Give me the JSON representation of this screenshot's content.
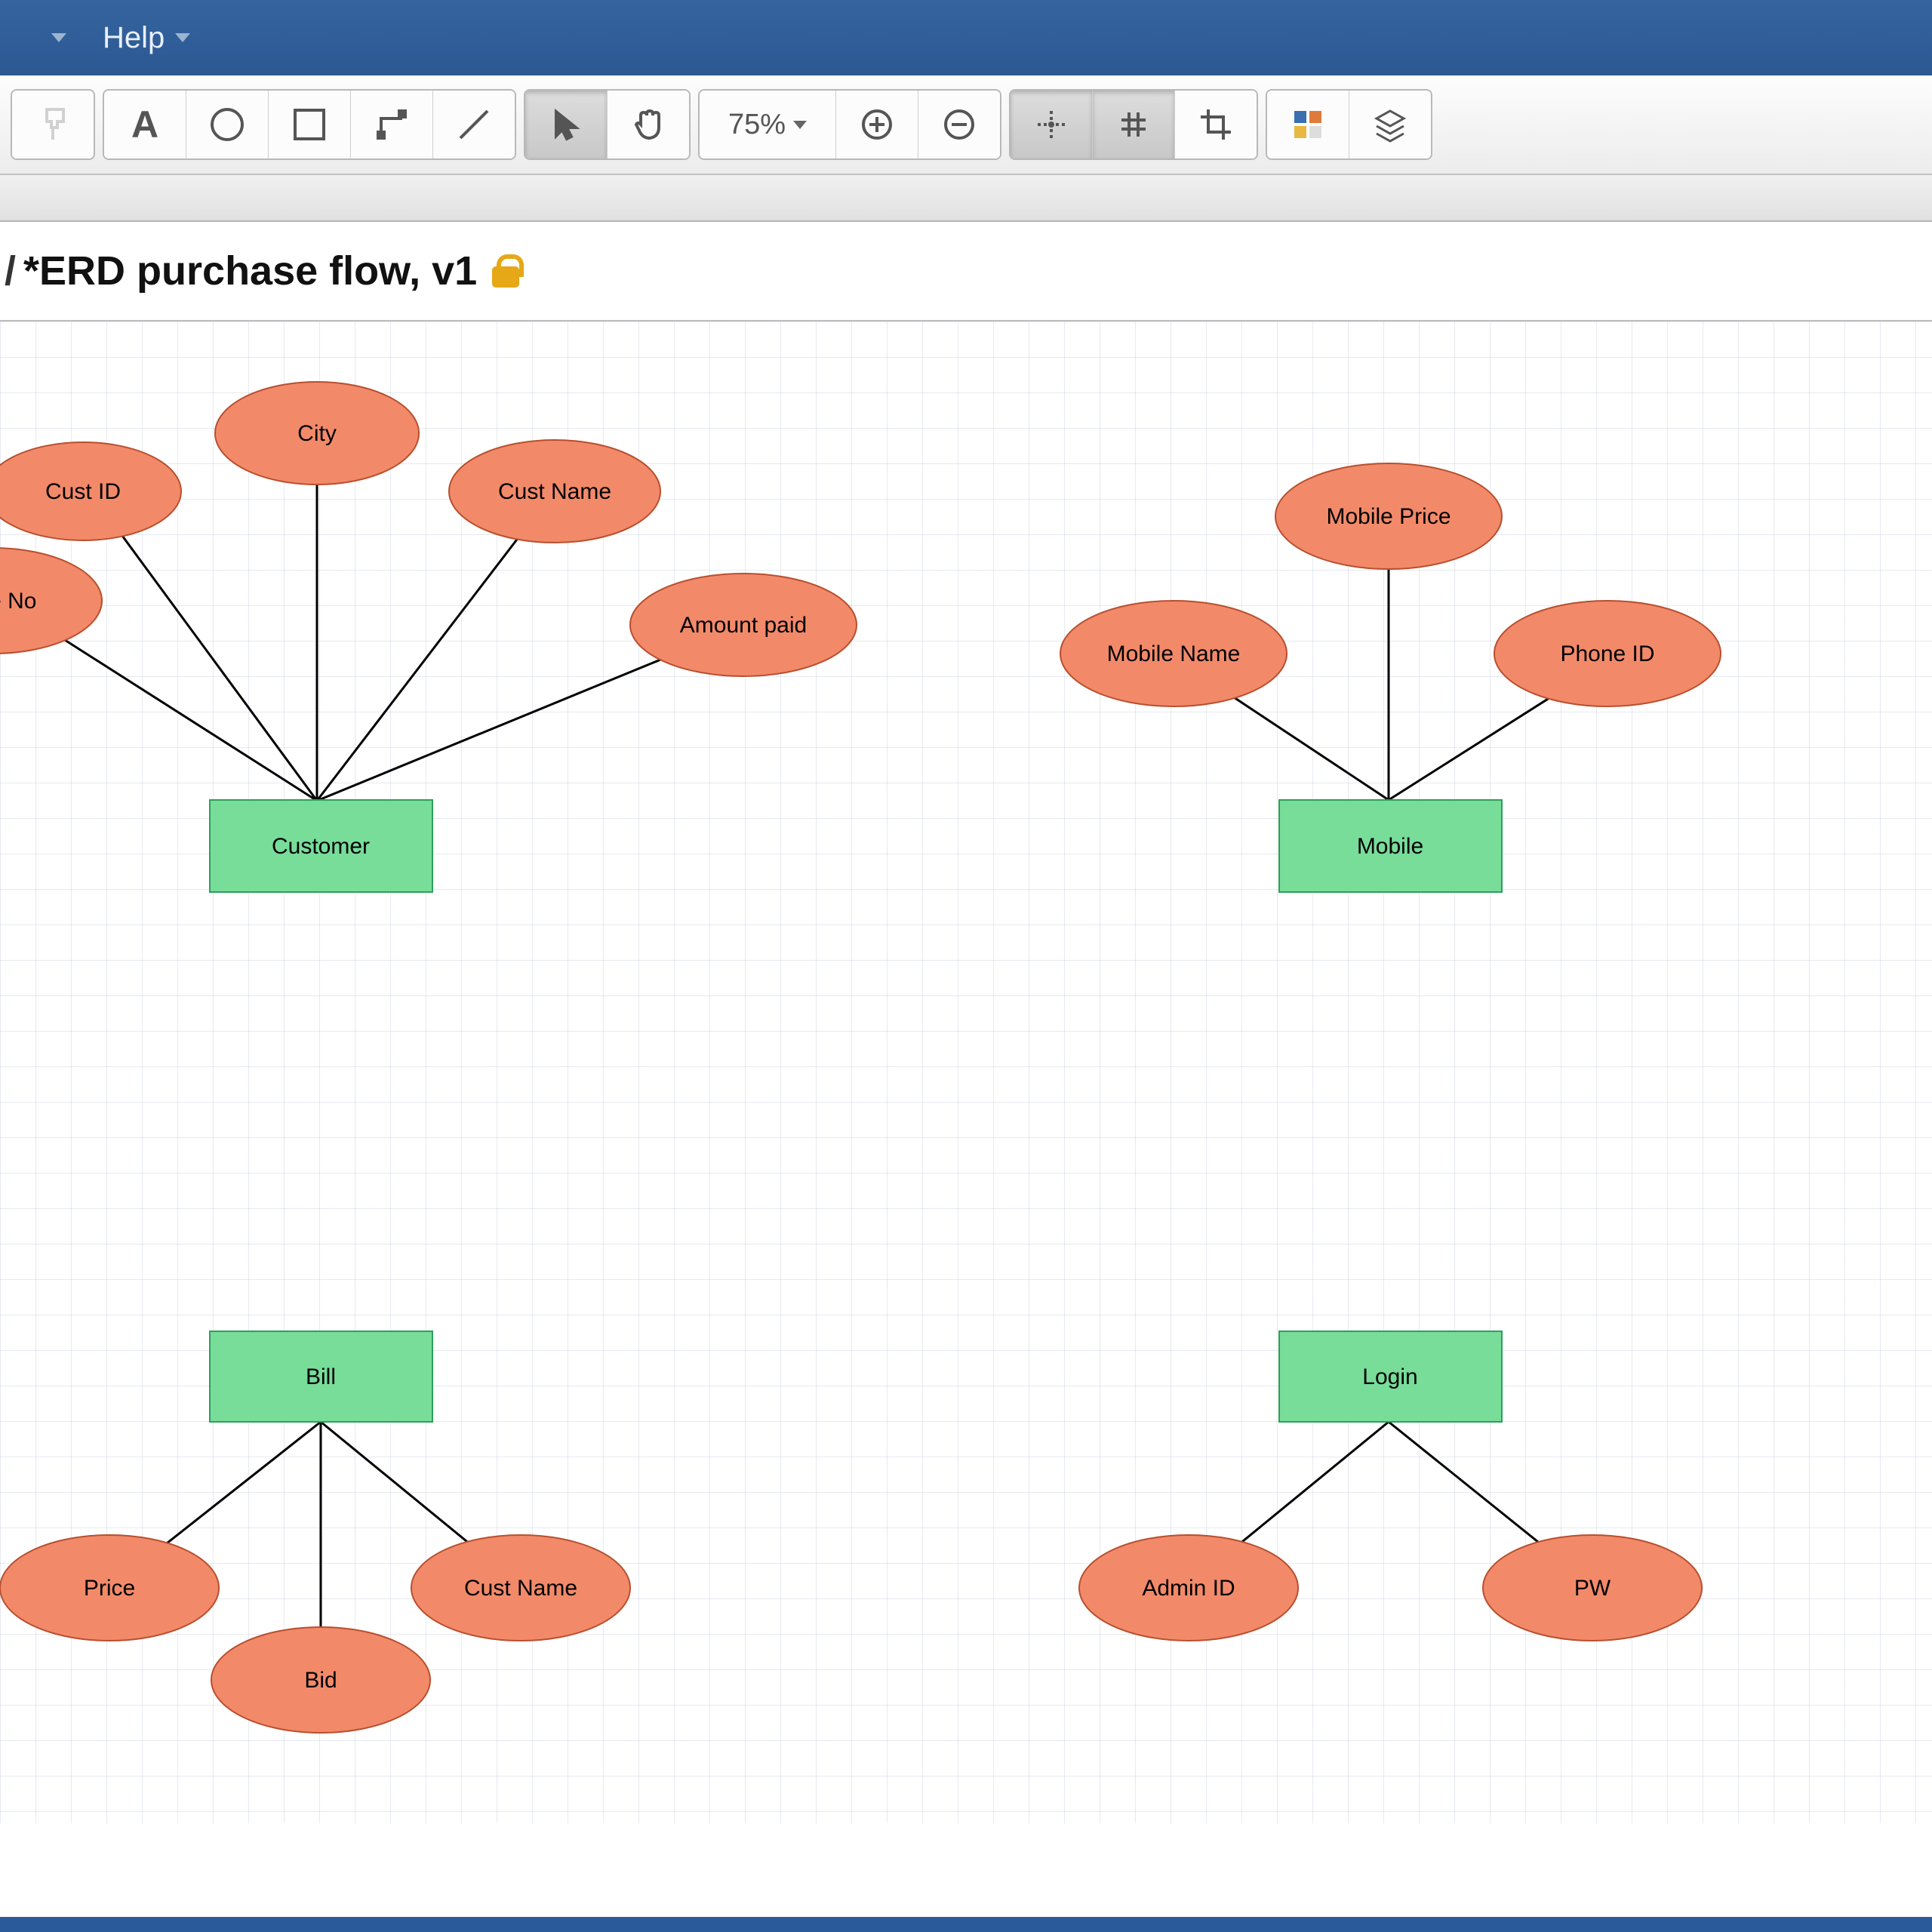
{
  "menubar": {
    "help": "Help"
  },
  "toolbar": {
    "zoom_label": "75%"
  },
  "doc": {
    "title_prefix": "/",
    "title": "*ERD purchase flow, v1"
  },
  "erd": {
    "entities": {
      "customer": "Customer",
      "mobile": "Mobile",
      "bill": "Bill",
      "login": "Login"
    },
    "attributes": {
      "customer": {
        "phone_no": "Phone No",
        "cust_id": "Cust ID",
        "city": "City",
        "cust_name": "Cust Name",
        "amount_paid": "Amount paid"
      },
      "mobile": {
        "mobile_name": "Mobile Name",
        "mobile_price": "Mobile Price",
        "phone_id": "Phone ID"
      },
      "bill": {
        "price": "Price",
        "bid": "Bid",
        "cust_name": "Cust Name"
      },
      "login": {
        "admin_id": "Admin ID",
        "pw": "PW"
      }
    }
  }
}
